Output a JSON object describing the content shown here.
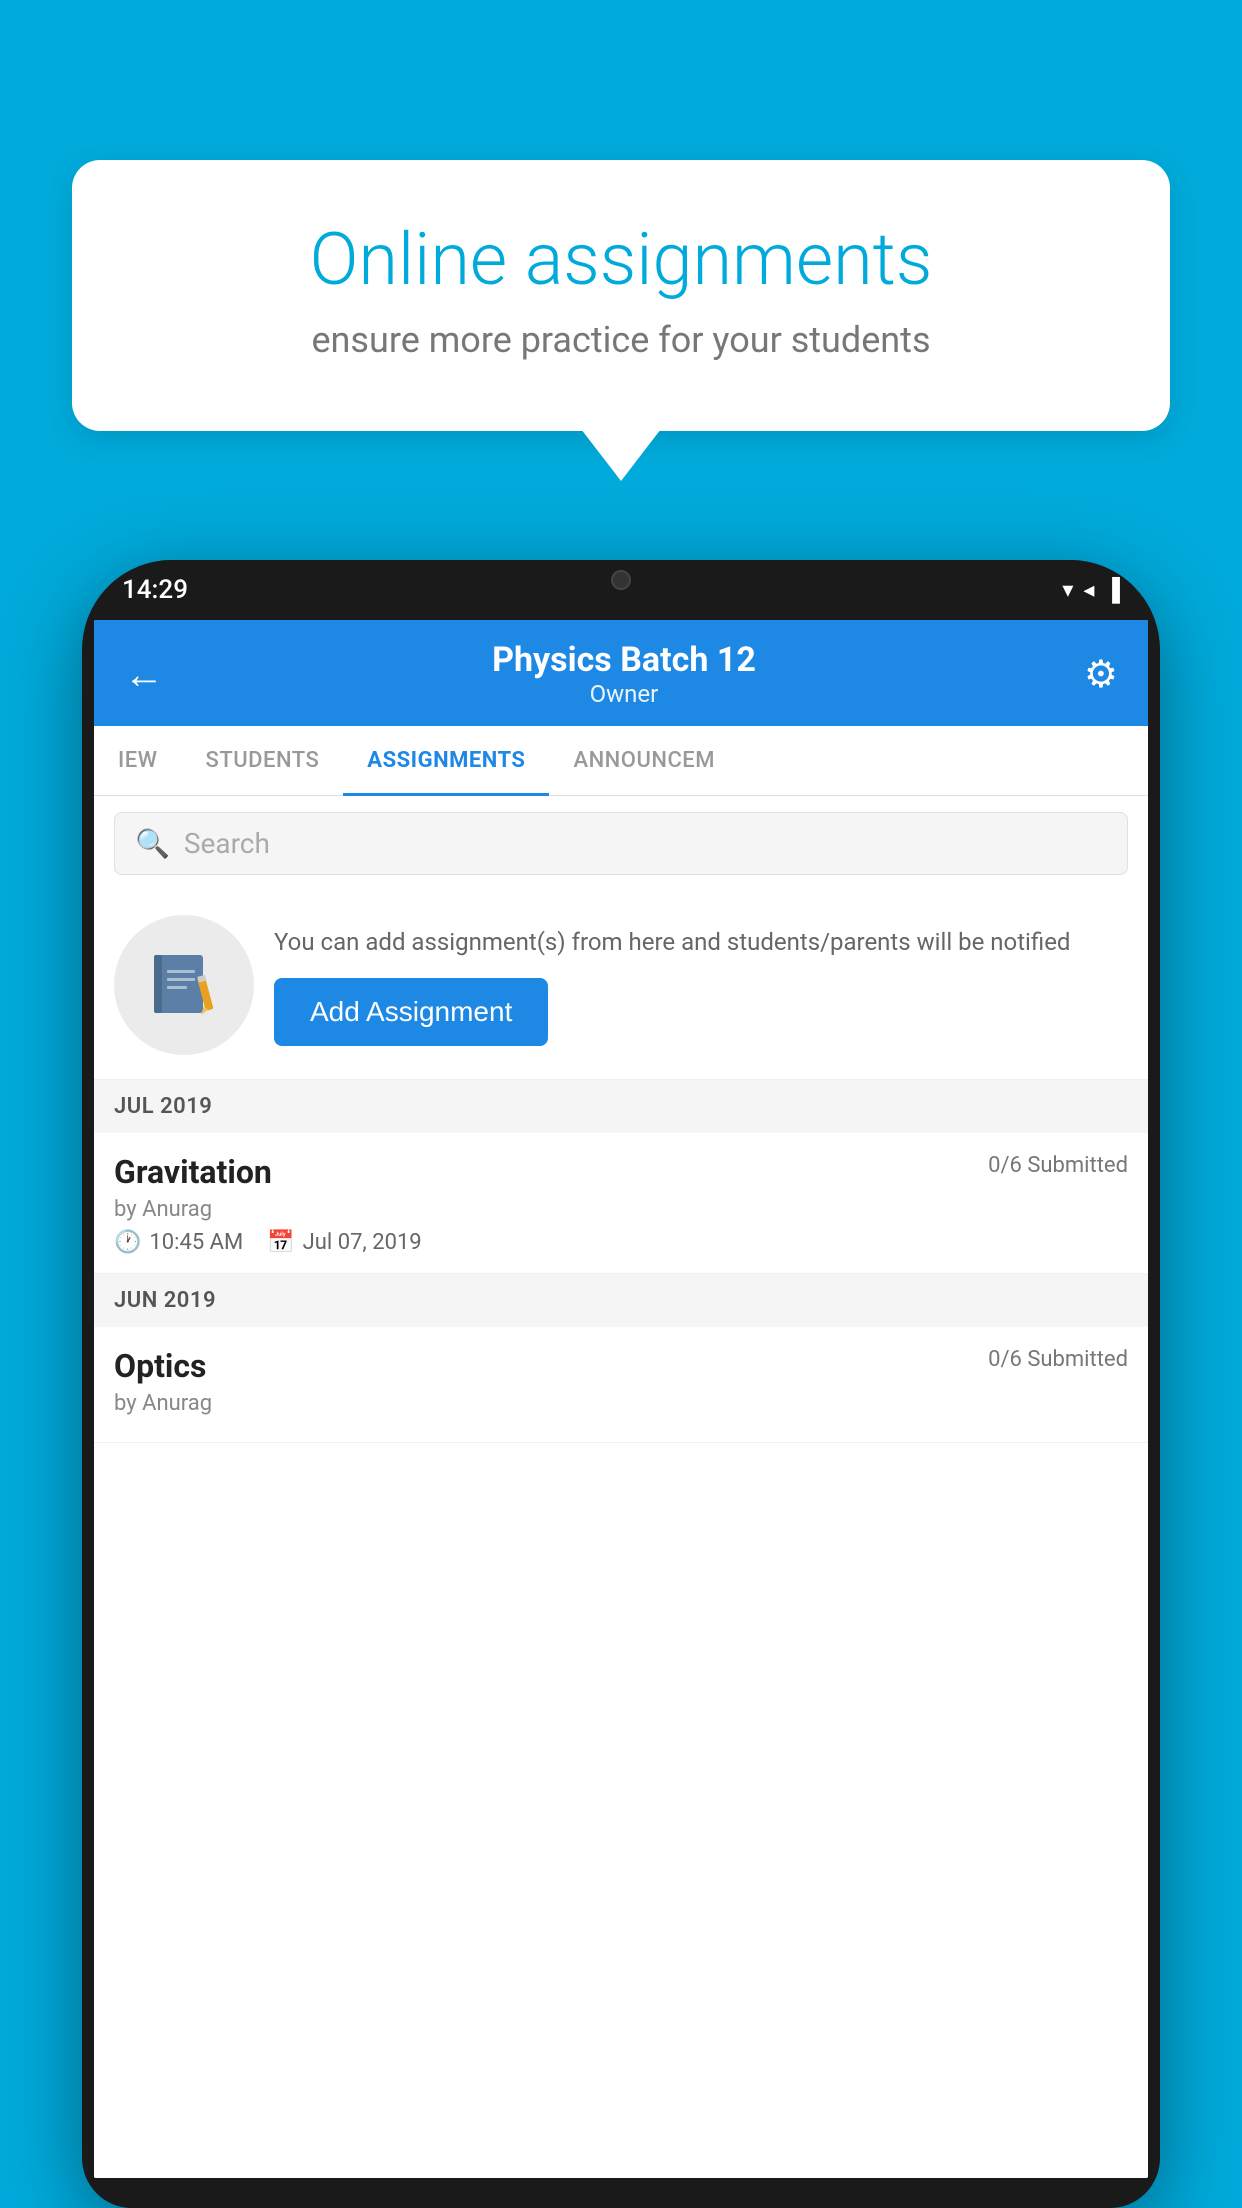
{
  "background": {
    "color": "#00AADB"
  },
  "speech_bubble": {
    "title": "Online assignments",
    "subtitle": "ensure more practice for your students"
  },
  "phone": {
    "time": "14:29",
    "status_icons": [
      "▼",
      "◀",
      "▌"
    ]
  },
  "app_header": {
    "back_label": "←",
    "title": "Physics Batch 12",
    "subtitle": "Owner",
    "gear_label": "⚙"
  },
  "tabs": [
    {
      "label": "IEW",
      "active": false
    },
    {
      "label": "STUDENTS",
      "active": false
    },
    {
      "label": "ASSIGNMENTS",
      "active": true
    },
    {
      "label": "ANNOUNCEM",
      "active": false
    }
  ],
  "search": {
    "placeholder": "Search"
  },
  "promo": {
    "description": "You can add assignment(s) from here and students/parents will be notified",
    "button_label": "Add Assignment"
  },
  "sections": [
    {
      "label": "JUL 2019",
      "assignments": [
        {
          "name": "Gravitation",
          "submitted": "0/6 Submitted",
          "by": "by Anurag",
          "time": "10:45 AM",
          "date": "Jul 07, 2019"
        }
      ]
    },
    {
      "label": "JUN 2019",
      "assignments": [
        {
          "name": "Optics",
          "submitted": "0/6 Submitted",
          "by": "by Anurag",
          "time": "",
          "date": ""
        }
      ]
    }
  ]
}
